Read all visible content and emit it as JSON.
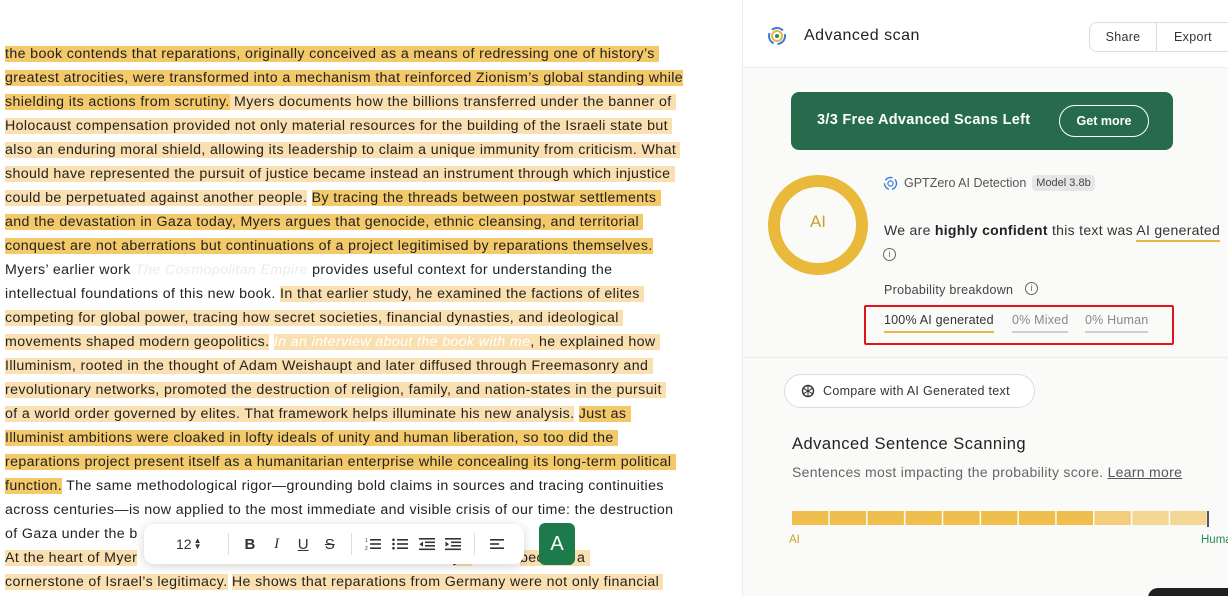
{
  "document": {
    "lines": [
      [
        {
          "t": "the book contends that reparations, originally conceived as a means of redressing one of history’s ",
          "h": "strong"
        }
      ],
      [
        {
          "t": "greatest atrocities, were transformed into a mechanism that reinforced Zionism’s global standing while",
          "h": "strong"
        }
      ],
      [
        {
          "t": "shielding its actions from scrutiny.",
          "h": "strong"
        },
        {
          "t": " Myers documents how the billions transferred under the banner of ",
          "h": "light"
        }
      ],
      [
        {
          "t": "Holocaust compensation provided not only material resources for the building of the Israeli state but ",
          "h": "light"
        }
      ],
      [
        {
          "t": "also an enduring moral shield, allowing its leadership to claim a unique immunity from criticism.",
          "h": "light"
        },
        {
          "t": " What ",
          "h": "light"
        }
      ],
      [
        {
          "t": "should have represented the pursuit of justice became instead an instrument through which injustice ",
          "h": "light"
        }
      ],
      [
        {
          "t": "could be perpetuated against another people.",
          "h": "light"
        },
        {
          "t": " ",
          "h": ""
        },
        {
          "t": "By tracing the threads between postwar settlements ",
          "h": "strong"
        }
      ],
      [
        {
          "t": "and the devastation in Gaza today, Myers argues that genocide, ethnic cleansing, and territorial ",
          "h": "strong"
        }
      ],
      [
        {
          "t": "conquest are not aberrations but continuations of a project legitimised by reparations themselves.",
          "h": "strong"
        }
      ],
      [
        {
          "t": "Myers’ earlier work ",
          "h": ""
        },
        {
          "t": "The Cosmopolitan Empire",
          "h": "link"
        },
        {
          "t": " provides useful context for understanding the",
          "h": ""
        }
      ],
      [
        {
          "t": "intellectual foundations of this new book. ",
          "h": ""
        },
        {
          "t": "In that earlier study, he examined the factions of elites ",
          "h": "light"
        }
      ],
      [
        {
          "t": "competing for global power, tracing how secret societies, financial dynasties, and ideological ",
          "h": "light"
        }
      ],
      [
        {
          "t": "movements shaped modern geopolitics.",
          "h": "light"
        },
        {
          "t": " ",
          "h": ""
        },
        {
          "t": "In an interview about the book with me",
          "h": "lightlink"
        },
        {
          "t": ", he explained how ",
          "h": "light"
        }
      ],
      [
        {
          "t": "Illuminism, rooted in the thought of Adam Weishaupt and later diffused through Freemasonry and ",
          "h": "light"
        }
      ],
      [
        {
          "t": "revolutionary networks, promoted the destruction of religion, family, and nation-states in the pursuit ",
          "h": "light"
        }
      ],
      [
        {
          "t": "of a world order governed by elites. That framework helps illuminate his new analysis.",
          "h": "light"
        },
        {
          "t": " ",
          "h": ""
        },
        {
          "t": "Just as ",
          "h": "strong"
        }
      ],
      [
        {
          "t": "Illuminist ambitions were cloaked in lofty ideals of unity and human liberation, so too did the ",
          "h": "strong"
        }
      ],
      [
        {
          "t": "reparations project present itself as a humanitarian enterprise while concealing its long-term political ",
          "h": "strong"
        }
      ],
      [
        {
          "t": "function.",
          "h": "strong"
        },
        {
          "t": " The same methodological rigor—grounding bold claims in sources and tracing continuities",
          "h": ""
        }
      ],
      [
        {
          "t": "across centuries—is now applied to the most immediate and visible crisis of our time: the destruction",
          "h": ""
        }
      ],
      [
        {
          "t": "of Gaza under the b",
          "h": ""
        }
      ],
      [
        {
          "t": "At the heart of Myer",
          "h": "light"
        },
        {
          "t": "                                                                         ",
          "h": ""
        },
        {
          "t": "ym",
          "h": "light"
        },
        {
          "t": "           ",
          "h": ""
        },
        {
          "t": "became a ",
          "h": "light"
        }
      ],
      [
        {
          "t": "cornerstone of Israel’s legitimacy.",
          "h": "light"
        },
        {
          "t": " ",
          "h": ""
        },
        {
          "t": "He shows that reparations from Germany were not only financial ",
          "h": "light"
        }
      ]
    ]
  },
  "toolbar": {
    "font_size": "12",
    "bold": "B",
    "italic": "I",
    "underline": "U",
    "strike": "S",
    "ai_button": "A"
  },
  "panel": {
    "title": "Advanced scan",
    "share_label": "Share",
    "export_label": "Export",
    "promo_text": "3/3 Free Advanced Scans Left",
    "promo_button": "Get more",
    "gauge_label": "AI",
    "detection_label": "GPTZero AI Detection",
    "model_badge": "Model 3.8b",
    "confidence_prefix": "We are ",
    "confidence_bold": "highly confident",
    "confidence_mid": " this text was ",
    "confidence_result": "AI generated",
    "prob_title": "Probability breakdown",
    "prob_ai": "100% AI generated",
    "prob_mixed": "0% Mixed",
    "prob_human": "0% Human",
    "compare_label": "Compare with AI Generated text",
    "adv_title": "Advanced Sentence Scanning",
    "adv_sub": "Sentences most impacting the probability score. ",
    "learn_more": "Learn more",
    "scale_ai": "AI",
    "scale_human": "Human",
    "accent_color": "#e5b64a",
    "promo_color": "#266b4b",
    "scale_segments": [
      "#f0be4d",
      "#f0be4d",
      "#f0be4d",
      "#f0be4d",
      "#f0be4d",
      "#f0be4d",
      "#f0be4d",
      "#f0be4d",
      "#f3cd7c",
      "#f5d795",
      "#f5d795"
    ]
  }
}
